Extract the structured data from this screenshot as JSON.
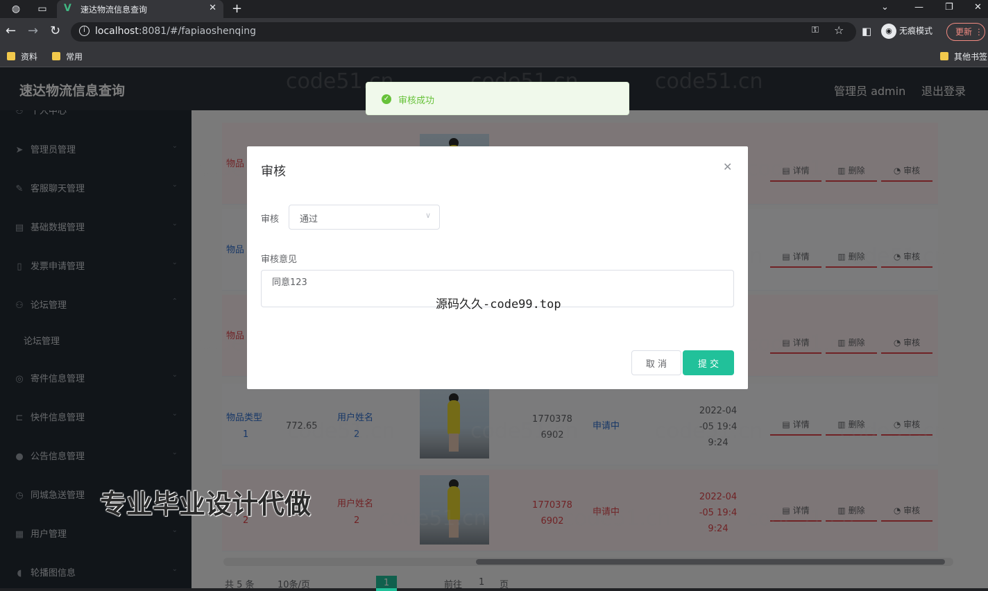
{
  "browser": {
    "tab_title": "速达物流信息查询",
    "url_host": "localhost",
    "url_rest": ":8081/#/fapiaoshenqing",
    "incognito_label": "无痕模式",
    "update_label": "更新",
    "bookmarks": [
      "资料",
      "常用"
    ],
    "other_bookmarks": "其他书签"
  },
  "header": {
    "brand": "速达物流信息查询",
    "user": "管理员 admin",
    "logout": "退出登录"
  },
  "sidebar": {
    "items": [
      {
        "label": "个人中心",
        "icon": "person-icon"
      },
      {
        "label": "管理员管理",
        "icon": "send-icon"
      },
      {
        "label": "客服聊天管理",
        "icon": "edit-icon"
      },
      {
        "label": "基础数据管理",
        "icon": "grid-icon"
      },
      {
        "label": "发票申请管理",
        "icon": "phone-icon"
      },
      {
        "label": "论坛管理",
        "icon": "person-icon"
      },
      {
        "label": "论坛管理",
        "icon": ""
      },
      {
        "label": "寄件信息管理",
        "icon": "globe-icon"
      },
      {
        "label": "快件信息管理",
        "icon": "crop-icon"
      },
      {
        "label": "公告信息管理",
        "icon": "pin-icon"
      },
      {
        "label": "同城急送管理",
        "icon": "clock-icon"
      },
      {
        "label": "用户管理",
        "icon": "apps-icon"
      },
      {
        "label": "轮播图信息",
        "icon": "mic-icon"
      }
    ]
  },
  "table": {
    "rows": [
      {
        "type_label": "物品",
        "type_val": "",
        "amount": "",
        "user_label": "",
        "user_val": "",
        "phone": "",
        "status": "",
        "time": ""
      },
      {
        "type_label": "物品",
        "type_val": "",
        "amount": "",
        "user_label": "",
        "user_val": "",
        "phone": "",
        "status": "",
        "time": ""
      },
      {
        "type_label": "物品",
        "type_val": "",
        "amount": "",
        "user_label": "",
        "user_val": "",
        "phone": "",
        "status": "",
        "time": ""
      },
      {
        "type_label": "物品类型",
        "type_val": "1",
        "amount": "772.65",
        "user_label": "用户姓名",
        "user_val": "2",
        "phone": "17703786902",
        "status": "申请中",
        "time": "2022-04-05 19:49:24"
      },
      {
        "type_label": "",
        "type_val": "2",
        "amount": "",
        "user_label": "用户姓名",
        "user_val": "2",
        "phone": "17703786902",
        "status": "申请中",
        "time": "2022-04-05 19:49:24"
      }
    ],
    "ops": {
      "detail": "详情",
      "delete": "删除",
      "audit": "审核"
    }
  },
  "pager": {
    "total": "共 5 条",
    "size": "10条/页",
    "current": "1",
    "goto": "前往",
    "goto_val": "1",
    "page_unit": "页"
  },
  "toast": {
    "message": "审核成功"
  },
  "dialog": {
    "title": "审核",
    "audit_label": "审核",
    "audit_value": "通过",
    "opinion_label": "审核意见",
    "opinion_value": "同意123",
    "cancel": "取 消",
    "submit": "提 交"
  },
  "overlays": {
    "watermark": "code51.cn",
    "text1": "源码久久-code99.top",
    "text2": "专业毕业设计代做"
  }
}
